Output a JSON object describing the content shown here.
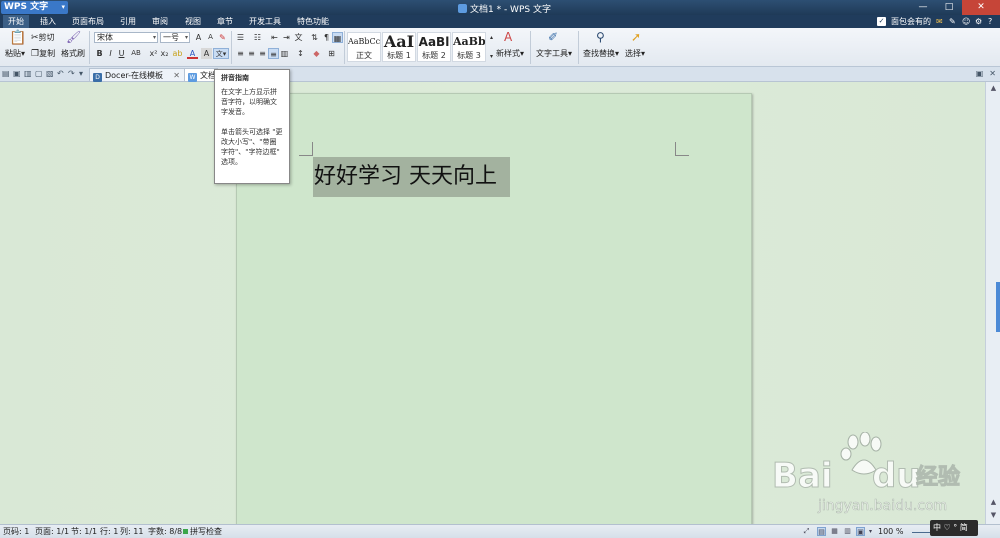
{
  "window": {
    "app_menu_label": "WPS 文字",
    "title": "文档1 * - WPS 文字"
  },
  "menu": {
    "tabs": [
      "开始",
      "插入",
      "页面布局",
      "引用",
      "审阅",
      "视图",
      "章节",
      "开发工具",
      "特色功能"
    ],
    "right_label": "面包会有的"
  },
  "ribbon": {
    "paste": "粘贴",
    "cut": "剪切",
    "copy": "复制",
    "format_painter": "格式刷",
    "font_name": "宋体",
    "font_size": "一号",
    "styles": [
      {
        "preview": "AaBbCc",
        "label": "正文"
      },
      {
        "preview": "AaI",
        "label": "标题 1"
      },
      {
        "preview": "AaBl",
        "label": "标题 2"
      },
      {
        "preview": "AaBb",
        "label": "标题 3"
      }
    ],
    "new_style": "新样式",
    "text_tools": "文字工具",
    "find_replace": "查找替换",
    "select": "选择"
  },
  "tabs": {
    "docer": "Docer-在线模板",
    "doc1": "文档"
  },
  "tooltip": {
    "title": "拼音指南",
    "para1": "在文字上方显示拼音字符，以明确文字发音。",
    "para2": "单击箭头可选择 \"更改大小写\"、\"带圈字符\"、\"字符边框\" 选项。"
  },
  "document": {
    "text": "好好学习  天天向上"
  },
  "status": {
    "page_no": "页码: 1",
    "pages": "页面: 1/1",
    "section": "节: 1/1",
    "row": "行: 1",
    "col": "列: 11",
    "word_count": "字数: 8/8",
    "spell_check": "拼写检查",
    "zoom": "100 %"
  },
  "ime": {
    "label": "中 ♡ ° 简"
  },
  "watermark": {
    "brand": "Bai du 经验",
    "url": "jingyan.baidu.com"
  },
  "colors": {
    "accent": "#3a78c8",
    "title_bar": "#1f3a57",
    "page_bg": "#cfe6cc",
    "selection": "#a3b29f"
  }
}
